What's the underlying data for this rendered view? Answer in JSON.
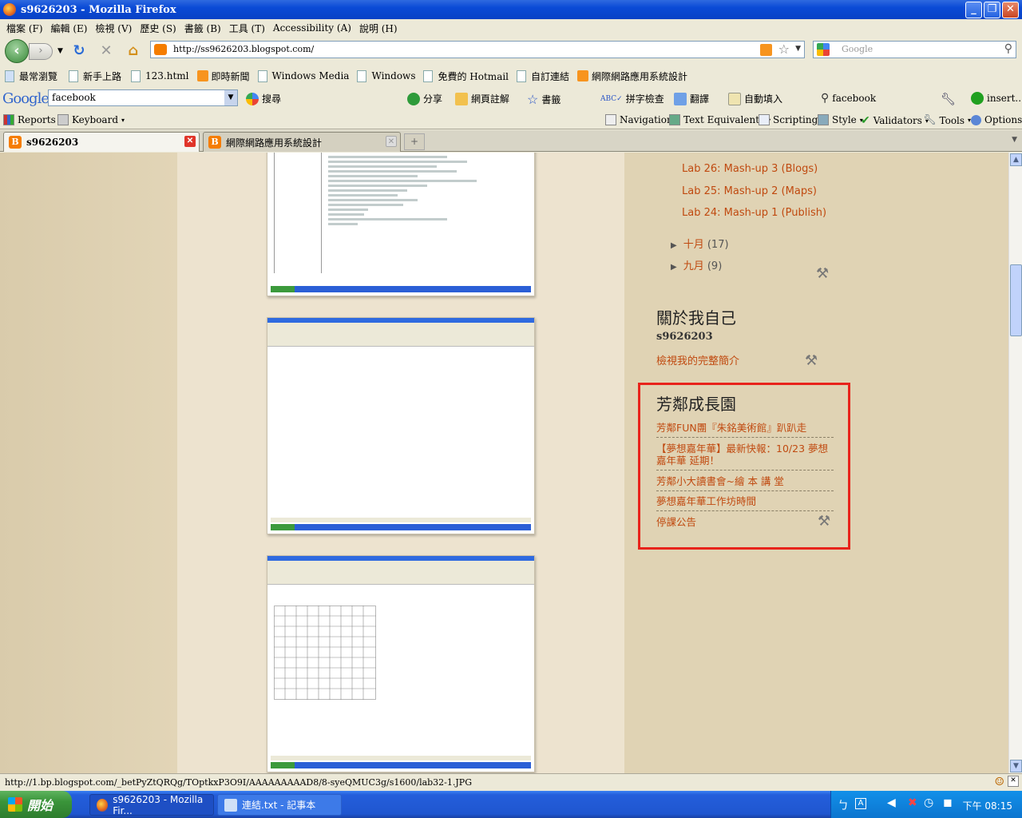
{
  "window": {
    "title": "s9626203 - Mozilla Firefox"
  },
  "menu": [
    "檔案 (F)",
    "編輯 (E)",
    "檢視 (V)",
    "歷史 (S)",
    "書籤 (B)",
    "工具 (T)",
    "Accessibility (A)",
    "說明 (H)"
  ],
  "nav": {
    "url": "http://ss9626203.blogspot.com/",
    "search_placeholder": "Google"
  },
  "bookmarks": [
    "最常瀏覽",
    "新手上路",
    "123.html",
    "即時新聞",
    "Windows Media",
    "Windows",
    "免費的 Hotmail",
    "自訂連結",
    "網際網路應用系統設計"
  ],
  "google_toolbar": {
    "logo": "Google",
    "query": "facebook",
    "items": [
      "搜尋",
      "分享",
      "網頁註解",
      "書籤",
      "拼字檢查",
      "翻譯",
      "自動填入",
      "facebook",
      "insert..."
    ]
  },
  "webdev": {
    "left": [
      "Reports",
      "Keyboard"
    ],
    "right": [
      "Navigation",
      "Text Equivalents",
      "Scripting",
      "Style",
      "Validators",
      "Tools",
      "Options"
    ]
  },
  "tabs": [
    {
      "label": "s9626203",
      "active": true
    },
    {
      "label": "網際網路應用系統設計",
      "active": false
    }
  ],
  "sidebar": {
    "lab_links": [
      "Lab 26: Mash-up 3 (Blogs)",
      "Lab 25: Mash-up 2 (Maps)",
      "Lab 24: Mash-up 1 (Publish)"
    ],
    "archive": [
      {
        "month": "十月",
        "count": "(17)"
      },
      {
        "month": "九月",
        "count": "(9)"
      }
    ],
    "about": {
      "heading": "關於我自己",
      "name": "s9626203",
      "profile_link": "檢視我的完整簡介"
    },
    "widget": {
      "heading": "芳鄰成長園",
      "links": [
        "芳鄰FUN團『朱銘美術館』趴趴走",
        "【夢想嘉年華】最新快報：10/23 夢想嘉年華 延期！",
        "芳鄰小大讀書會~繪 本 講 堂",
        "夢想嘉年華工作坊時間",
        "停課公告"
      ]
    }
  },
  "status": {
    "text": "http://1.bp.blogspot.com/_betPyZtQRQg/TOptkxP3O9I/AAAAAAAAAD8/8-syeQMUC3g/s1600/lab32-1.JPG"
  },
  "taskbar": {
    "start": "開始",
    "tasks": [
      "s9626203 - Mozilla Fir...",
      "連結.txt - 記事本"
    ],
    "clock": "下午 08:15"
  }
}
